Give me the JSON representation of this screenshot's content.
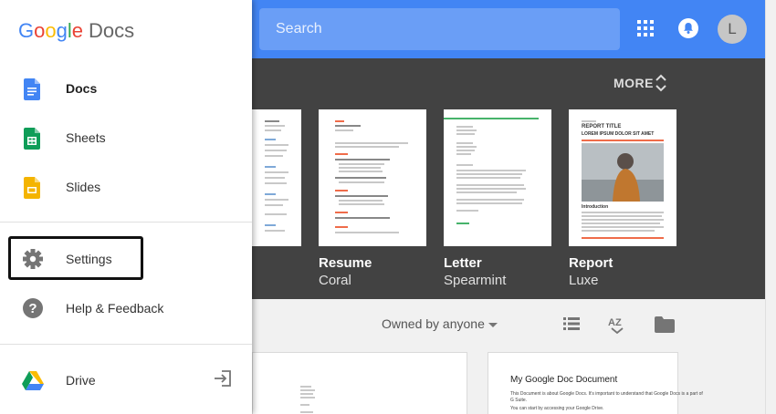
{
  "header": {
    "search_placeholder": "Search",
    "avatar_initial": "L",
    "brand_color": "#4285f4"
  },
  "drawer": {
    "logo_google": [
      "G",
      "o",
      "o",
      "g",
      "l",
      "e"
    ],
    "logo_product": "Docs",
    "items": [
      {
        "label": "Docs",
        "icon": "docs-icon",
        "active": true
      },
      {
        "label": "Sheets",
        "icon": "sheets-icon"
      },
      {
        "label": "Slides",
        "icon": "slides-icon"
      },
      {
        "label": "Settings",
        "icon": "gear-icon"
      },
      {
        "label": "Help & Feedback",
        "icon": "help-icon"
      },
      {
        "label": "Drive",
        "icon": "drive-icon"
      }
    ]
  },
  "templates": {
    "more_label": "MORE",
    "items": [
      {
        "name": "Resume",
        "style": "Coral"
      },
      {
        "name": "Letter",
        "style": "Spearmint"
      },
      {
        "name": "Report",
        "style": "Luxe"
      }
    ],
    "report_preview": {
      "title": "REPORT TITLE",
      "subtitle": "LOREM IPSUM DOLOR SIT AMET",
      "section": "Introduction"
    }
  },
  "documents": {
    "owner_filter": "Owned by anyone",
    "sort_label": "AZ",
    "recent_doc": {
      "title": "My Google Doc Document",
      "line1": "This Document is about Google Docs. It's important to understand that Google Docs is a part of",
      "line2": "G Suite.",
      "line3": "You can start by accessing your Google Drive."
    }
  }
}
